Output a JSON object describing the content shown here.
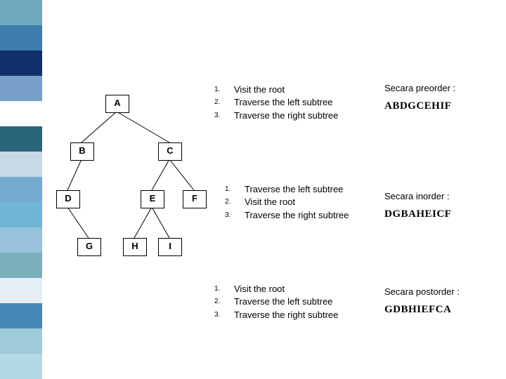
{
  "tree": {
    "nodes": {
      "A": "A",
      "B": "B",
      "C": "C",
      "D": "D",
      "E": "E",
      "F": "F",
      "G": "G",
      "H": "H",
      "I": "I"
    }
  },
  "blocks": {
    "preorder": {
      "steps": [
        {
          "n": "1.",
          "t": "Visit the root"
        },
        {
          "n": "2.",
          "t": "Traverse the left subtree"
        },
        {
          "n": "3.",
          "t": "Traverse the right subtree"
        }
      ],
      "title": "Secara preorder :",
      "result": "ABDGCEHIF"
    },
    "inorder": {
      "steps": [
        {
          "n": "1.",
          "t": "Traverse the left subtree"
        },
        {
          "n": "2.",
          "t": "Visit the root"
        },
        {
          "n": "3.",
          "t": "Traverse the right subtree"
        }
      ],
      "title": "Secara inorder :",
      "result": "DGBAHEICF"
    },
    "postorder": {
      "steps": [
        {
          "n": "1.",
          "t": "Visit the root"
        },
        {
          "n": "2.",
          "t": "Traverse the left subtree"
        },
        {
          "n": "3.",
          "t": "Traverse the right subtree"
        }
      ],
      "title": "Secara postorder :",
      "result": "GDBHIEFCA"
    }
  },
  "chart_data": {
    "type": "tree",
    "nodes": [
      "A",
      "B",
      "C",
      "D",
      "E",
      "F",
      "G",
      "H",
      "I"
    ],
    "edges": [
      [
        "A",
        "B"
      ],
      [
        "A",
        "C"
      ],
      [
        "B",
        "D"
      ],
      [
        "C",
        "E"
      ],
      [
        "C",
        "F"
      ],
      [
        "D",
        "G"
      ],
      [
        "E",
        "H"
      ],
      [
        "E",
        "I"
      ]
    ],
    "traversals": {
      "preorder": "ABDGCEHIF",
      "inorder": "DGBAHEICF",
      "postorder": "GDBHIEFCA"
    }
  }
}
